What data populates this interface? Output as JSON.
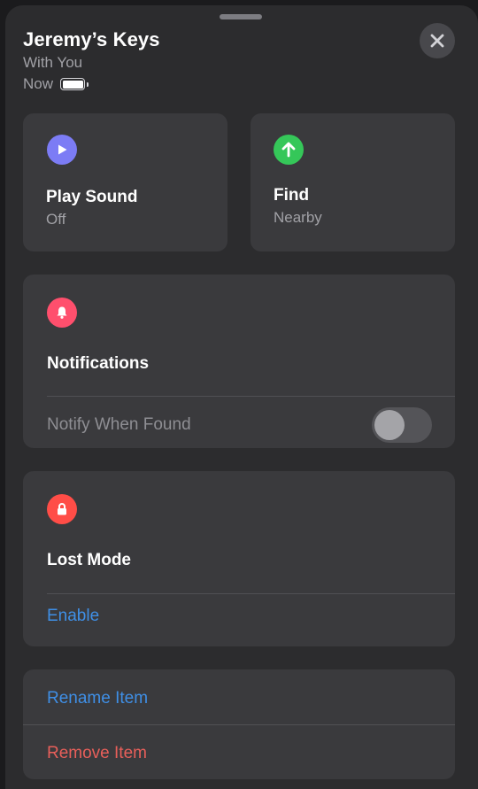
{
  "header": {
    "title": "Jeremy’s Keys",
    "subtitle": "With You",
    "time": "Now"
  },
  "play_sound": {
    "title": "Play Sound",
    "status": "Off",
    "icon": "play-icon",
    "color": "#7c7cf5"
  },
  "find": {
    "title": "Find",
    "status": "Nearby",
    "icon": "arrow-up-icon",
    "color": "#35c759"
  },
  "notifications": {
    "title": "Notifications",
    "icon": "bell-icon",
    "color": "#ff4f6d",
    "notify_label": "Notify When Found",
    "notify_enabled": false
  },
  "lost_mode": {
    "title": "Lost Mode",
    "icon": "lock-icon",
    "color": "#ff4d47",
    "action": "Enable"
  },
  "item_actions": {
    "rename": "Rename Item",
    "remove": "Remove Item"
  },
  "colors": {
    "link_blue": "#3f8fe6",
    "destructive_red": "#e85f5a"
  }
}
